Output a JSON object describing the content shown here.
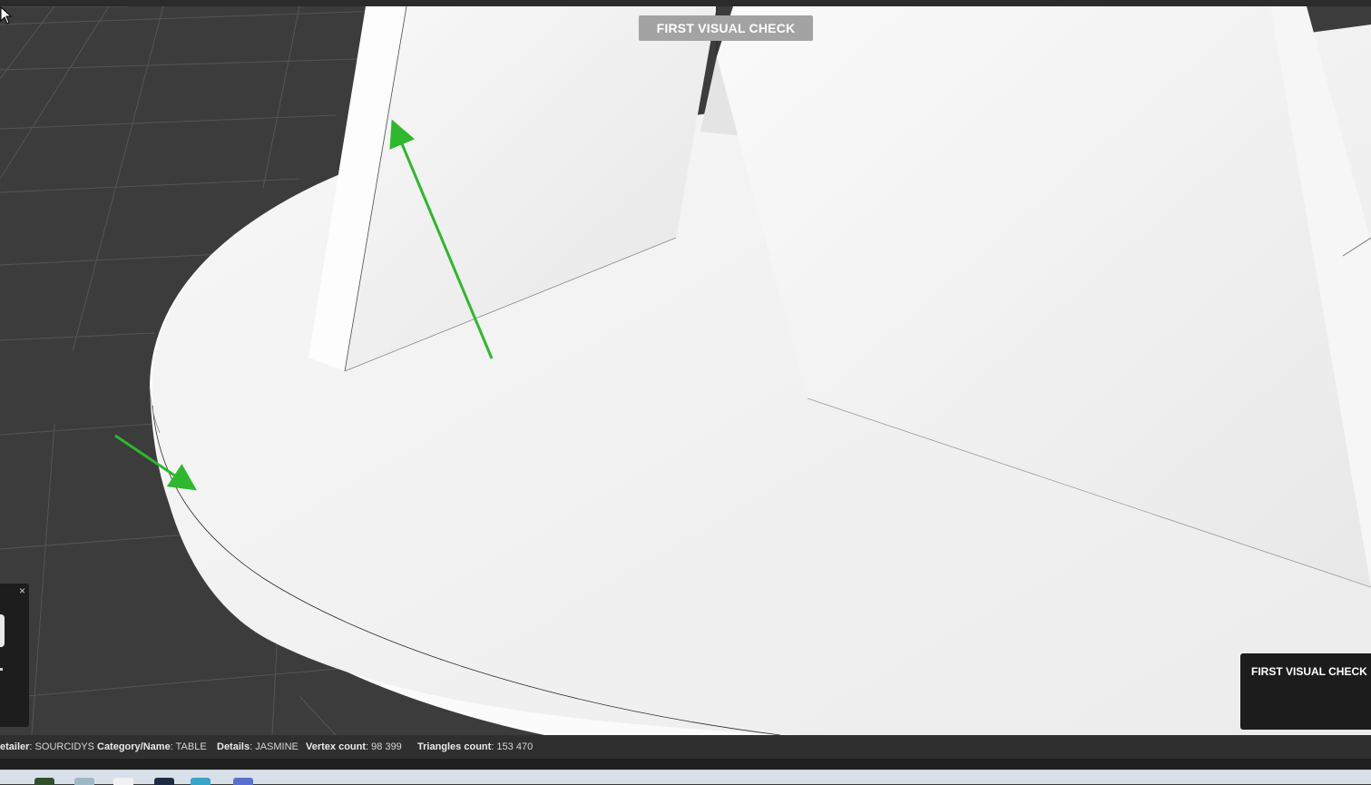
{
  "viewer": {
    "check_title": "FIRST VISUAL CHECK",
    "panel_title": "FIRST VISUAL CHECK",
    "close_symbol": "×"
  },
  "status": {
    "retailer_label": "etailer",
    "retailer_value": "SOURCIDYS",
    "category_label": "Category/Name",
    "category_value": "TABLE",
    "details_label": "Details",
    "details_value": "JASMINE",
    "vertex_label": "Vertex count",
    "vertex_value": "98 399",
    "triangles_label": "Triangles count",
    "triangles_value": "153 470"
  },
  "colors": {
    "annotation_arrow": "#2db82d",
    "model_surface": "#f2f2f2",
    "grid_background": "#3c3c3c"
  },
  "icons": [
    "mouse-cursor-icon",
    "close-icon",
    "arrow-annotation"
  ]
}
